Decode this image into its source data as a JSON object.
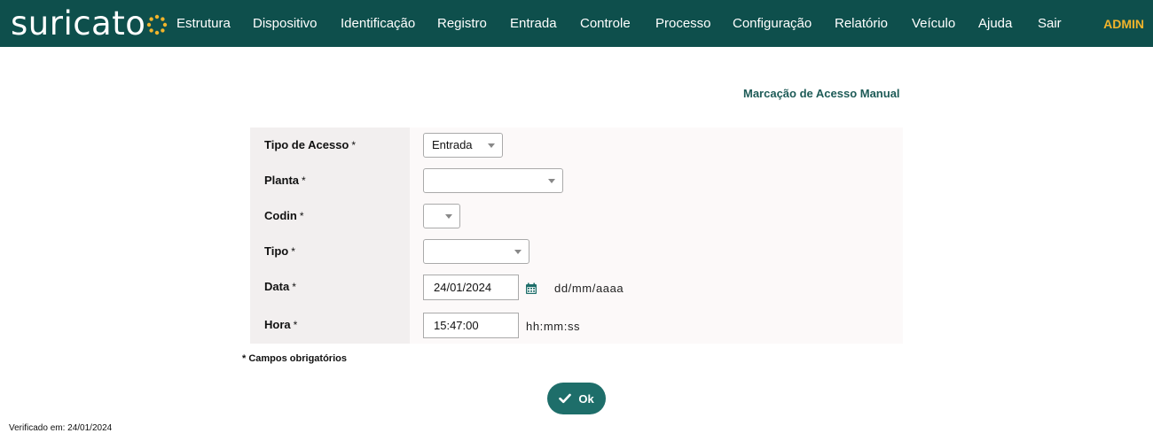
{
  "brand": {
    "name": "suricato"
  },
  "nav": {
    "items": [
      "Estrutura",
      "Dispositivo",
      "Identificação",
      "Registro",
      "Entrada",
      "Controle",
      "Processo",
      "Configuração",
      "Relatório",
      "Veículo",
      "Ajuda",
      "Sair"
    ],
    "user": "ADMIN"
  },
  "page": {
    "title": "Marcação de Acesso Manual"
  },
  "form": {
    "tipo_acesso": {
      "label": "Tipo de Acesso",
      "value": "Entrada"
    },
    "planta": {
      "label": "Planta",
      "value": ""
    },
    "codin": {
      "label": "Codin",
      "value": ""
    },
    "tipo": {
      "label": "Tipo",
      "value": ""
    },
    "data": {
      "label": "Data",
      "value": "24/01/2024",
      "hint": "dd/mm/aaaa"
    },
    "hora": {
      "label": "Hora",
      "value": "15:47:00",
      "hint": "hh:mm:ss"
    },
    "required_mark": "*",
    "required_note": "* Campos obrigatórios",
    "submit_label": "Ok"
  },
  "footer": {
    "verified": "Verificado em: 24/01/2024"
  },
  "colors": {
    "topbar": "#0e4f4c",
    "accent": "#1e6e6a",
    "user": "#f1b42b",
    "logo_dots": "#f1b42b"
  },
  "icons": {
    "calendar": "calendar-icon",
    "check": "check-icon",
    "dropdown": "chevron-down-icon"
  }
}
